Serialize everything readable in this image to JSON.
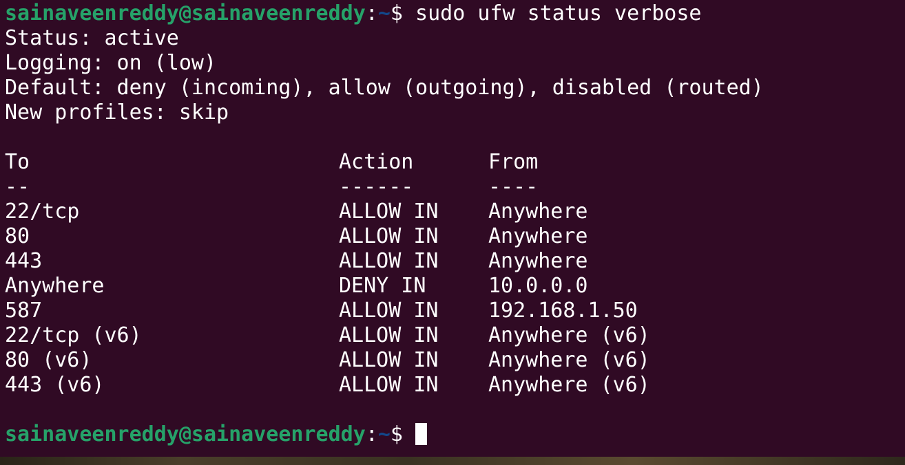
{
  "prompt": {
    "user_host": "sainaveenreddy@sainaveenreddy",
    "colon": ":",
    "path": "~",
    "dollar": "$ "
  },
  "command": "sudo ufw status verbose",
  "status_lines": [
    "Status: active",
    "Logging: on (low)",
    "Default: deny (incoming), allow (outgoing), disabled (routed)",
    "New profiles: skip"
  ],
  "table": {
    "headers": [
      "To",
      "Action",
      "From"
    ],
    "separators": [
      "--",
      "------",
      "----"
    ],
    "rows": [
      {
        "to": "22/tcp",
        "action": "ALLOW IN",
        "from": "Anywhere"
      },
      {
        "to": "80",
        "action": "ALLOW IN",
        "from": "Anywhere"
      },
      {
        "to": "443",
        "action": "ALLOW IN",
        "from": "Anywhere"
      },
      {
        "to": "Anywhere",
        "action": "DENY IN",
        "from": "10.0.0.0"
      },
      {
        "to": "587",
        "action": "ALLOW IN",
        "from": "192.168.1.50"
      },
      {
        "to": "22/tcp (v6)",
        "action": "ALLOW IN",
        "from": "Anywhere (v6)"
      },
      {
        "to": "80 (v6)",
        "action": "ALLOW IN",
        "from": "Anywhere (v6)"
      },
      {
        "to": "443 (v6)",
        "action": "ALLOW IN",
        "from": "Anywhere (v6)"
      }
    ]
  },
  "colors": {
    "background": "#300a24",
    "prompt_user": "#26a269",
    "prompt_path": "#12488b",
    "text": "#ffffff"
  }
}
